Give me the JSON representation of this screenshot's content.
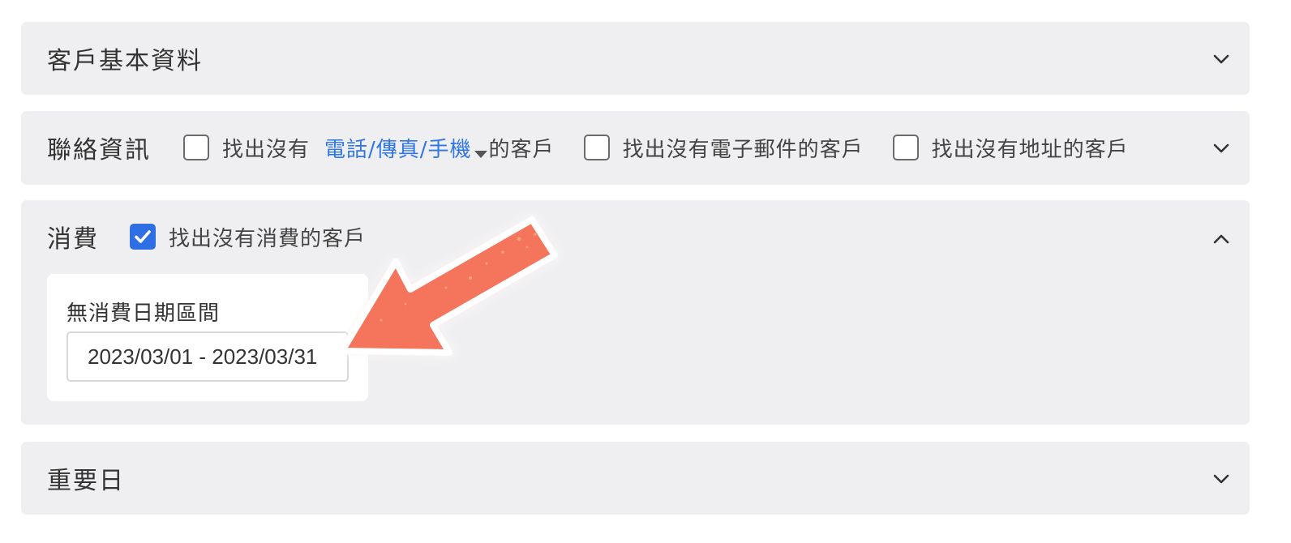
{
  "sections": {
    "basic": {
      "title": "客戶基本資料",
      "icon": "chevron-down-icon"
    },
    "contact": {
      "title": "聯絡資訊",
      "filter1_prefix": "找出沒有",
      "filter1_dropdown": "電話/傳真/手機",
      "filter1_suffix": "的客戶",
      "filter1_checked": false,
      "filter2_label": "找出沒有電子郵件的客戶",
      "filter2_checked": false,
      "filter3_label": "找出沒有地址的客戶",
      "filter3_checked": false,
      "icon": "chevron-down-icon"
    },
    "consumption": {
      "title": "消費",
      "filter_label": "找出沒有消費的客戶",
      "filter_checked": true,
      "date_range_label": "無消費日期區間",
      "date_range_value": "2023/03/01 - 2023/03/31",
      "icon": "chevron-up-icon"
    },
    "important_dates": {
      "title": "重要日",
      "icon": "chevron-down-icon"
    }
  },
  "colors": {
    "panel_bg": "#efeff1",
    "accent": "#2f76e8",
    "checkbox_checked": "#2f6fe4",
    "annotation_arrow": "#f4745c"
  },
  "annotation": {
    "icon": "pointer-arrow-icon"
  }
}
